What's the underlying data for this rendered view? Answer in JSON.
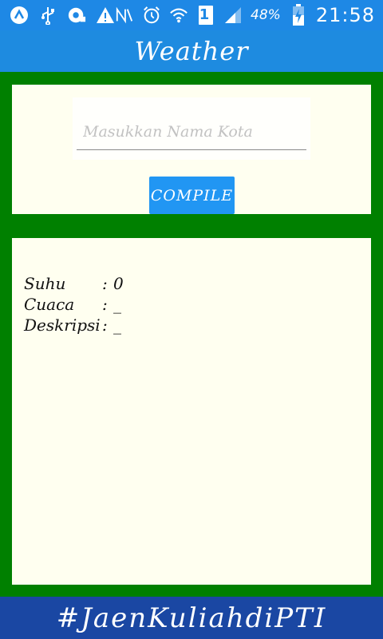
{
  "status_bar": {
    "left_icons": [
      "app-circle-icon",
      "usb-icon",
      "screen-record-icon",
      "warning-icon"
    ],
    "right_icons": [
      "nfc-icon",
      "alarm-icon",
      "wifi-icon",
      "sim-1-icon",
      "signal-icon",
      "battery-charging-icon"
    ],
    "sim_slot": "1",
    "battery": "48%",
    "time": "21:58"
  },
  "app_bar": {
    "title": "Weather"
  },
  "form": {
    "city_placeholder": "Masukkan Nama Kota",
    "city_value": "",
    "compile_label": "COMPILE"
  },
  "result": {
    "suhu_label": "Suhu",
    "suhu_value": "0",
    "cuaca_label": "Cuaca",
    "cuaca_value": "_",
    "deskripsi_label": "Deskripsi",
    "deskripsi_value": "_",
    "separator": ":"
  },
  "footer": {
    "text": "#JaenKuliahdiPTI"
  },
  "colors": {
    "status_bar": "#1E88E5",
    "app_bar": "#1E8BE0",
    "frame_green": "#008000",
    "card_bg": "#FFFFF0",
    "button": "#2196F3",
    "footer": "#1A47A3"
  }
}
